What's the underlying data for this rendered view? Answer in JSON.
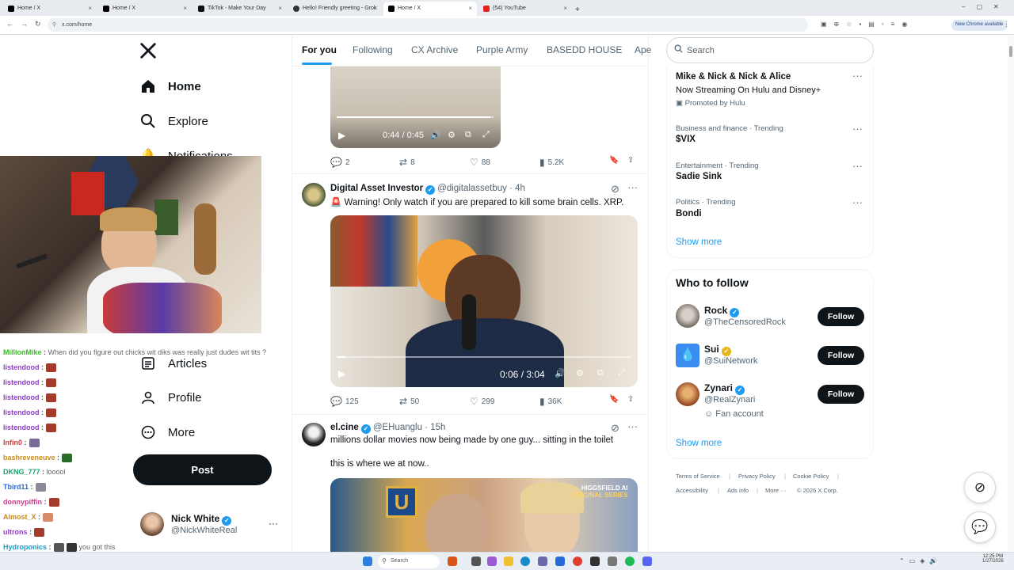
{
  "browser": {
    "tabs": [
      {
        "title": "Home / X",
        "favicon": "x-logo-icon",
        "active": false
      },
      {
        "title": "Home / X",
        "favicon": "x-logo-icon",
        "active": false
      },
      {
        "title": "TikTok - Make Your Day",
        "favicon": "tiktok-icon",
        "active": false
      },
      {
        "title": "Hello! Friendly greeting - Grok",
        "favicon": "grok-icon",
        "active": false
      },
      {
        "title": "Home / X",
        "favicon": "x-logo-icon",
        "active": true
      },
      {
        "title": "(54) YouTube",
        "favicon": "youtube-icon",
        "active": false
      }
    ],
    "new_tab": "+",
    "url": "x.com/home",
    "update_badge": "New Chrome available"
  },
  "sidebar": {
    "logo": "X",
    "items": [
      {
        "label": "Home",
        "icon": "home-icon"
      },
      {
        "label": "Explore",
        "icon": "search-icon"
      },
      {
        "label": "Notifications",
        "icon": "bell-icon"
      },
      {
        "label": "Articles",
        "icon": "article-icon"
      },
      {
        "label": "Profile",
        "icon": "person-icon"
      },
      {
        "label": "More",
        "icon": "more-circle-icon"
      }
    ],
    "post_label": "Post",
    "account": {
      "name": "Nick White",
      "handle": "@NickWhiteReal"
    }
  },
  "chat": [
    {
      "user": "MillionMike",
      "color": "#3cb82b",
      "message": "When did you figure out chicks wit diks was really just dudes wit tits ?"
    },
    {
      "user": "listendood",
      "color": "#8f3cc9",
      "message": ""
    },
    {
      "user": "listendood",
      "color": "#8f3cc9",
      "message": ""
    },
    {
      "user": "listendood",
      "color": "#8f3cc9",
      "message": ""
    },
    {
      "user": "listendood",
      "color": "#8f3cc9",
      "message": ""
    },
    {
      "user": "listendood",
      "color": "#8f3cc9",
      "message": ""
    },
    {
      "user": "Infin0",
      "color": "#c93c3c",
      "message": ""
    },
    {
      "user": "bashreveneuve",
      "color": "#c98d1a",
      "message": ""
    },
    {
      "user": "DKNG_777",
      "color": "#1aa36d",
      "message": "looool"
    },
    {
      "user": "Tbird11",
      "color": "#2b6cc9",
      "message": ""
    },
    {
      "user": "donnypiffin",
      "color": "#c93c8d",
      "message": ""
    },
    {
      "user": "Almost_X",
      "color": "#c9891a",
      "message": ""
    },
    {
      "user": "ultrons",
      "color": "#8f3cc9",
      "message": ""
    },
    {
      "user": "Hydroponics",
      "color": "#1a9cc9",
      "message": "you got this"
    }
  ],
  "feed": {
    "tabs": [
      "For you",
      "Following",
      "CX Archive",
      "Purple Army",
      "BASEDD HOUSE",
      "Ape"
    ],
    "post1": {
      "video_time": "0:44 / 0:45",
      "progress": 0.98,
      "replies": "2",
      "reposts": "8",
      "likes": "88",
      "views": "5.2K"
    },
    "post2": {
      "name": "Digital Asset Investor",
      "handle": "@digitalassetbuy",
      "time": "4h",
      "text": "Warning! Only watch if you are prepared to kill some brain cells. XRP.",
      "text_prefix": "🚨",
      "video_time": "0:06 / 3:04",
      "progress": 0.03,
      "replies": "125",
      "reposts": "50",
      "likes": "299",
      "views": "36K"
    },
    "post3": {
      "name": "el.cine",
      "handle": "@EHuanglu",
      "time": "15h",
      "text": "millions dollar movies now being made by one guy... sitting in the toilet",
      "text2": "this is where we at now..",
      "video_badge_1": "HIGGSFIELD AI",
      "video_badge_2": "ORIGINAL SERIES"
    }
  },
  "right": {
    "search_placeholder": "Search",
    "promo": {
      "title": "Mike & Nick & Nick & Alice",
      "subtitle": "Now Streaming On Hulu and Disney+",
      "promoted": "Promoted by Hulu"
    },
    "trends": [
      {
        "category": "Business and finance · Trending",
        "title": "$VIX"
      },
      {
        "category": "Entertainment · Trending",
        "title": "Sadie Sink"
      },
      {
        "category": "Politics · Trending",
        "title": "Bondi"
      }
    ],
    "show_more": "Show more",
    "who_to_follow": "Who to follow",
    "follows": [
      {
        "name": "Rock",
        "handle": "@TheCensoredRock",
        "badge": "blue",
        "extra": ""
      },
      {
        "name": "Sui",
        "handle": "@SuiNetwork",
        "badge": "gold",
        "extra": ""
      },
      {
        "name": "Zynari",
        "handle": "@RealZynari",
        "badge": "blue",
        "extra": "Fan account"
      }
    ],
    "follow_label": "Follow",
    "footer": {
      "links": [
        "Terms of Service",
        "Privacy Policy",
        "Cookie Policy",
        "Accessibility",
        "Ads info",
        "More ···"
      ],
      "copyright": "© 2026 X Corp."
    }
  },
  "taskbar": {
    "search": "Search",
    "time": "12:25 PM",
    "date": "1/27/2026"
  },
  "colors": {
    "accent": "#1d9bf0",
    "text": "#0f1419",
    "muted": "#536471"
  }
}
